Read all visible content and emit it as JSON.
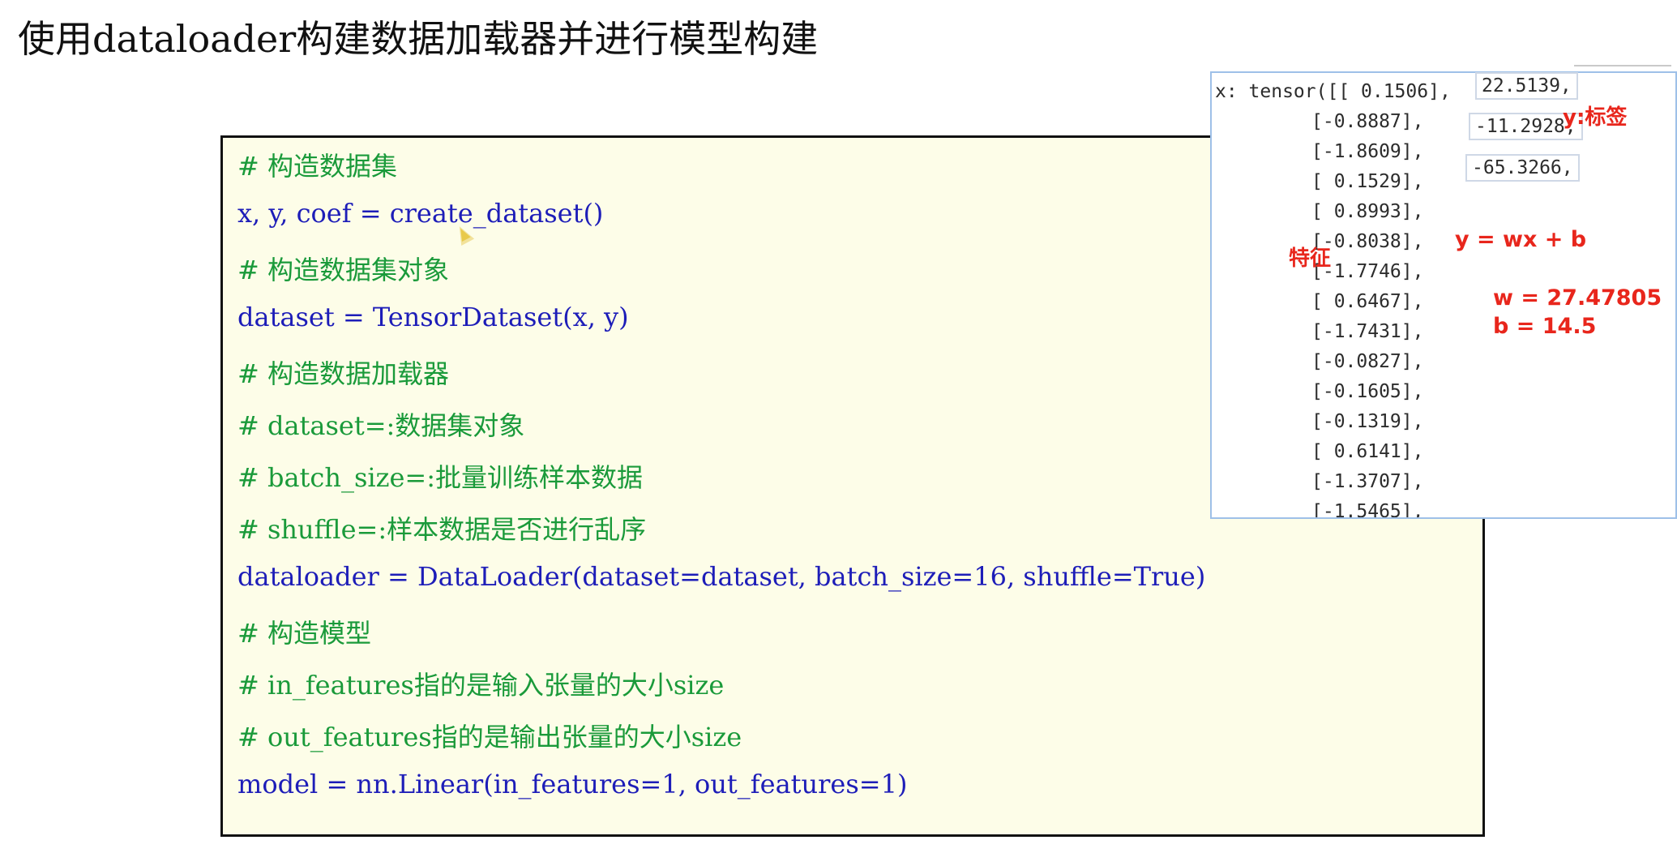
{
  "slide": {
    "title": "使用dataloader构建数据加载器并进行模型构建"
  },
  "code_lines": [
    {
      "kind": "comment",
      "text": "# 构造数据集"
    },
    {
      "kind": "code",
      "text": "x, y, coef = create_dataset()"
    },
    {
      "kind": "comment",
      "text": "# 构造数据集对象"
    },
    {
      "kind": "code",
      "text": "dataset = TensorDataset(x, y)"
    },
    {
      "kind": "comment",
      "text": "# 构造数据加载器"
    },
    {
      "kind": "comment",
      "text": "# dataset=:数据集对象"
    },
    {
      "kind": "comment",
      "text": "# batch_size=:批量训练样本数据"
    },
    {
      "kind": "comment",
      "text": "# shuffle=:样本数据是否进行乱序"
    },
    {
      "kind": "code",
      "text": "dataloader = DataLoader(dataset=dataset, batch_size=16, shuffle=True)"
    },
    {
      "kind": "comment",
      "text": "# 构造模型"
    },
    {
      "kind": "comment",
      "text": "# in_features指的是输入张量的大小size"
    },
    {
      "kind": "comment",
      "text": "# out_features指的是输出张量的大小size"
    },
    {
      "kind": "code",
      "text": " model = nn.Linear(in_features=1, out_features=1)"
    }
  ],
  "console": {
    "lines": [
      "x: tensor([[ 0.1506],",
      "[-0.8887],",
      "[-1.8609],",
      "[ 0.1529],",
      "[ 0.8993],",
      "[-0.8038],",
      "[-1.7746],",
      "[ 0.6467],",
      "[-1.7431],",
      "[-0.0827],",
      "[-0.1605],",
      "[-0.1319],",
      "[ 0.6141],",
      "[-1.3707],",
      "[-1.5465],"
    ],
    "y_values": [
      "22.5139,",
      "-11.2928,",
      "-65.3266,"
    ]
  },
  "annotations": {
    "y_label": "y:标签",
    "feature_label": "特征",
    "formula": "y = wx + b",
    "w_value": "w = 27.47805",
    "b_value": "b = 14.5"
  }
}
